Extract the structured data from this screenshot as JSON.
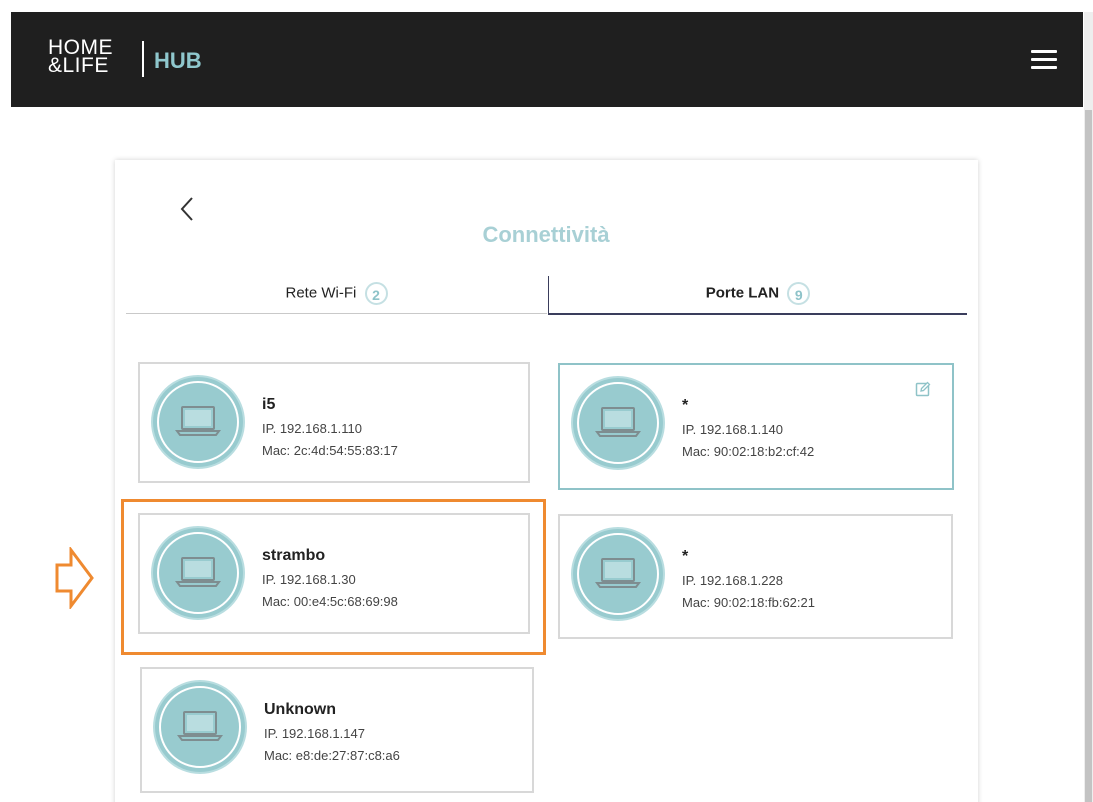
{
  "header": {
    "logo_line1": "HOME",
    "logo_line2": "&LIFE",
    "hub": "HUB"
  },
  "page": {
    "title": "Connettività"
  },
  "tabs": [
    {
      "label": "Rete Wi-Fi",
      "count": "2"
    },
    {
      "label": "Porte LAN",
      "count": "9",
      "active": true
    }
  ],
  "devices": [
    {
      "name": "i5",
      "ip": "IP. 192.168.1.110",
      "mac": "Mac: 2c:4d:54:55:83:17"
    },
    {
      "name": "*",
      "ip": "IP. 192.168.1.140",
      "mac": "Mac: 90:02:18:b2:cf:42"
    },
    {
      "name": "strambo",
      "ip": "IP. 192.168.1.30",
      "mac": "Mac: 00:e4:5c:68:69:98"
    },
    {
      "name": "*",
      "ip": "IP. 192.168.1.228",
      "mac": "Mac: 90:02:18:fb:62:21"
    },
    {
      "name": "Unknown",
      "ip": "IP. 192.168.1.147",
      "mac": "Mac: e8:de:27:87:c8:a6"
    }
  ],
  "colors": {
    "accent": "#8fc7cd",
    "header_bg": "#1f1f1f",
    "highlight": "#ef8a30",
    "tab_active": "#3a3d5c"
  },
  "icons": {
    "device": "laptop-icon",
    "edit": "edit-icon",
    "back": "chevron-left-icon",
    "menu": "hamburger-menu-icon",
    "annotation": "arrow-right-icon"
  }
}
